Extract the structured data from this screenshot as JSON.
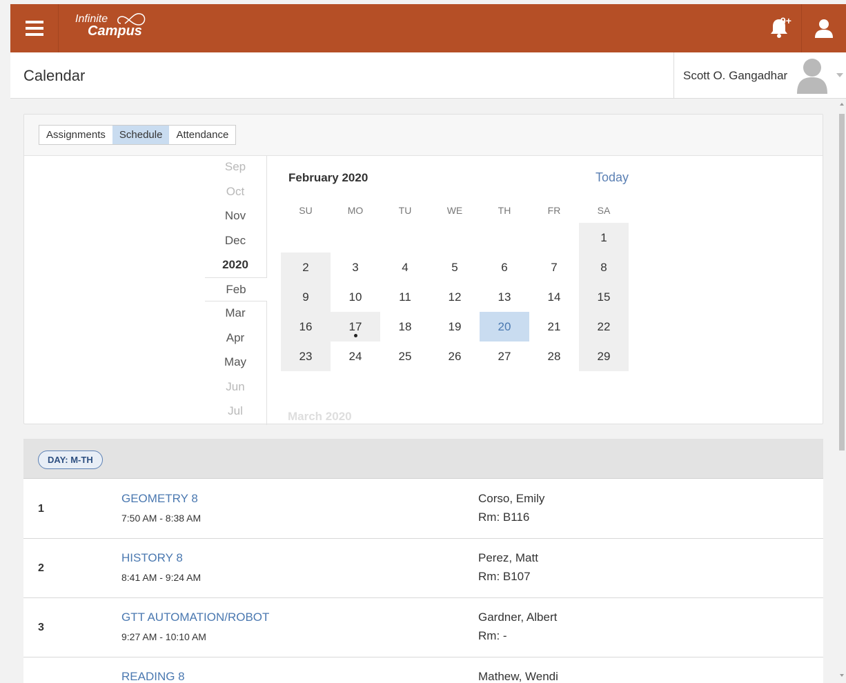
{
  "app": {
    "logo_line1": "Infinite",
    "logo_line2": "Campus",
    "notification_badge": "9+",
    "brand_color": "#b54f26"
  },
  "header": {
    "title": "Calendar",
    "user_name": "Scott O. Gangadhar"
  },
  "tabs": [
    {
      "label": "Assignments",
      "active": false
    },
    {
      "label": "Schedule",
      "active": true
    },
    {
      "label": "Attendance",
      "active": false
    }
  ],
  "months": [
    "Sep",
    "Oct",
    "Nov",
    "Dec",
    "2020",
    "Feb",
    "Mar",
    "Apr",
    "May",
    "Jun",
    "Jul"
  ],
  "calendar": {
    "title": "February 2020",
    "today_label": "Today",
    "weekdays": [
      "SU",
      "MO",
      "TU",
      "WE",
      "TH",
      "FR",
      "SA"
    ],
    "selected_day": "20",
    "marked_day": "17",
    "next_month_title": "March 2020",
    "weeks": [
      [
        "",
        "",
        "",
        "",
        "",
        "",
        "1"
      ],
      [
        "2",
        "3",
        "4",
        "5",
        "6",
        "7",
        "8"
      ],
      [
        "9",
        "10",
        "11",
        "12",
        "13",
        "14",
        "15"
      ],
      [
        "16",
        "17",
        "18",
        "19",
        "20",
        "21",
        "22"
      ],
      [
        "23",
        "24",
        "25",
        "26",
        "27",
        "28",
        "29"
      ]
    ]
  },
  "schedule": {
    "day_label": "DAY: M-TH",
    "periods": [
      {
        "period": "1",
        "course": "GEOMETRY 8",
        "time": "7:50 AM - 8:38 AM",
        "teacher": "Corso, Emily",
        "room": "Rm: B116"
      },
      {
        "period": "2",
        "course": "HISTORY 8",
        "time": "8:41 AM - 9:24 AM",
        "teacher": "Perez, Matt",
        "room": "Rm: B107"
      },
      {
        "period": "3",
        "course": "GTT AUTOMATION/ROBOT",
        "time": "9:27 AM - 10:10 AM",
        "teacher": "Gardner, Albert",
        "room": "Rm: -"
      },
      {
        "period": "4",
        "course": "READING 8",
        "time": "",
        "teacher": "Mathew, Wendi",
        "room": ""
      }
    ]
  }
}
